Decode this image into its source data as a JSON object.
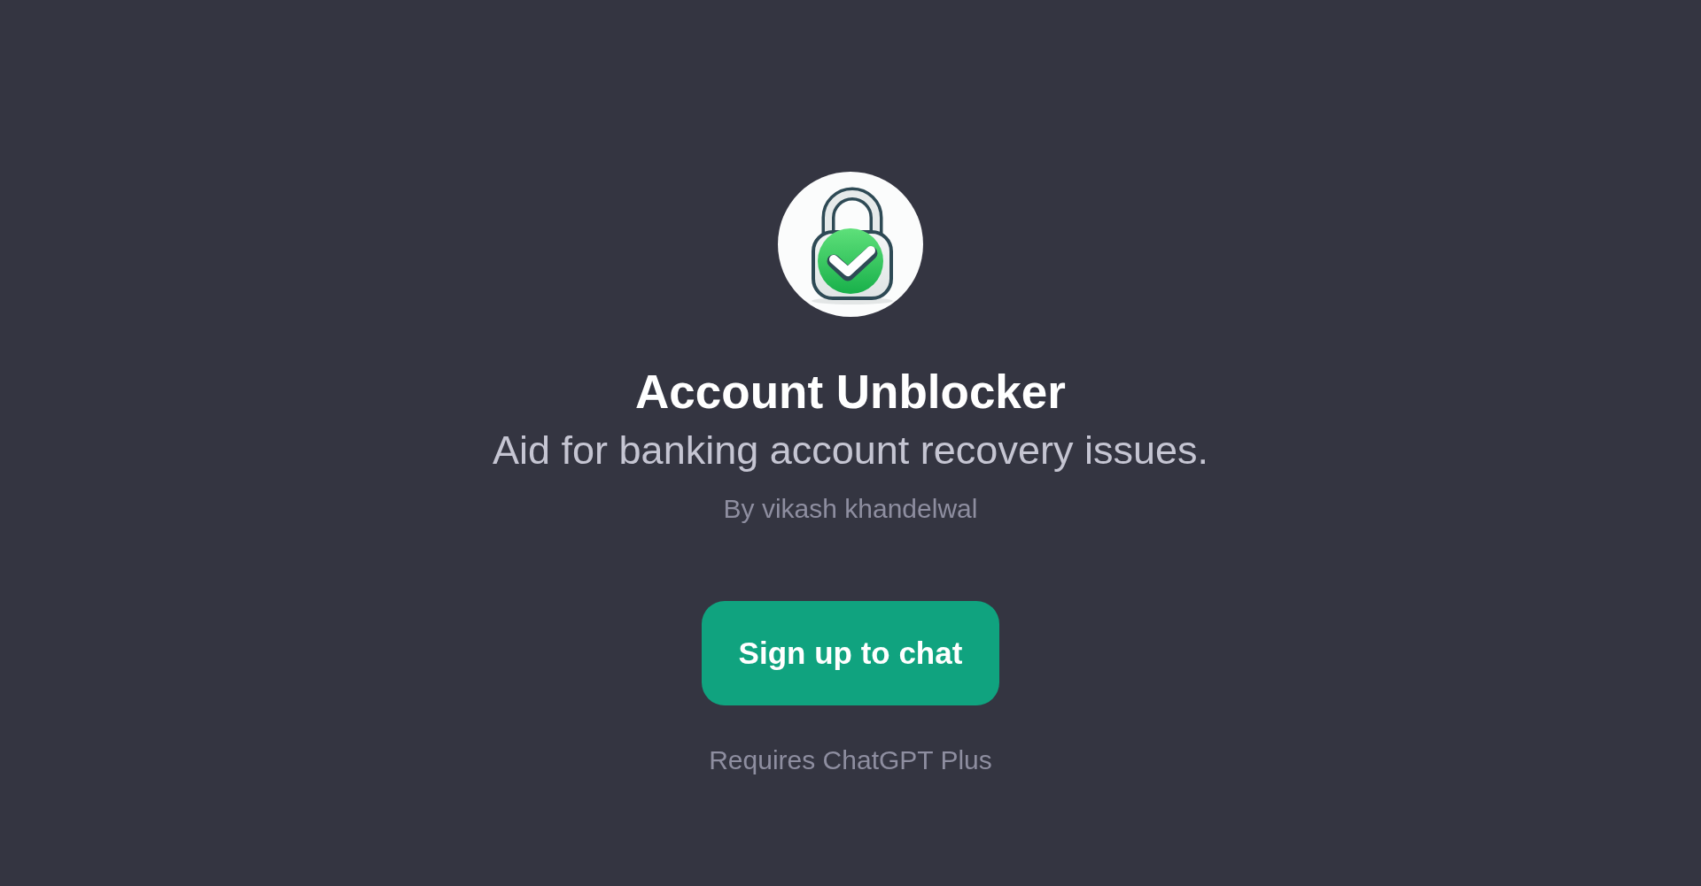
{
  "gpt": {
    "title": "Account Unblocker",
    "description": "Aid for banking account recovery issues.",
    "author": "By vikash khandelwal"
  },
  "signup_button": {
    "label": "Sign up to chat"
  },
  "requirement": "Requires ChatGPT Plus"
}
